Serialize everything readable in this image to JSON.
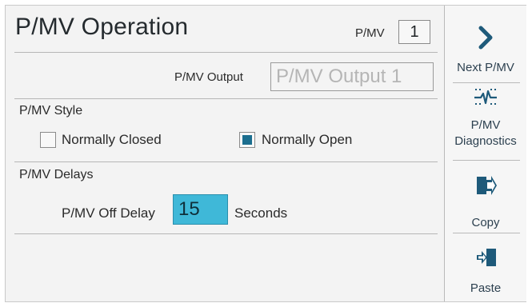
{
  "header": {
    "title": "P/MV Operation",
    "pmv_label": "P/MV",
    "pmv_number": "1"
  },
  "output": {
    "label": "P/MV Output",
    "value": "P/MV  Output 1"
  },
  "style": {
    "heading": "P/MV Style",
    "options": [
      {
        "label": "Normally Closed",
        "checked": false
      },
      {
        "label": "Normally Open",
        "checked": true
      }
    ]
  },
  "delays": {
    "heading": "P/MV Delays",
    "off_delay_label": "P/MV Off Delay",
    "off_delay_value": "15",
    "unit": "Seconds"
  },
  "sidebar": {
    "buttons": [
      {
        "label": "Next P/MV",
        "icon": "chevron-right-icon"
      },
      {
        "label_line1": "P/MV",
        "label_line2": "Diagnostics",
        "icon": "diagnostics-icon"
      },
      {
        "label": "Copy",
        "icon": "copy-icon"
      },
      {
        "label": "Paste",
        "icon": "paste-icon"
      }
    ]
  },
  "colors": {
    "accent": "#3fb8d8",
    "icon": "#1e5a7a",
    "checked": "#1b6e8f"
  }
}
